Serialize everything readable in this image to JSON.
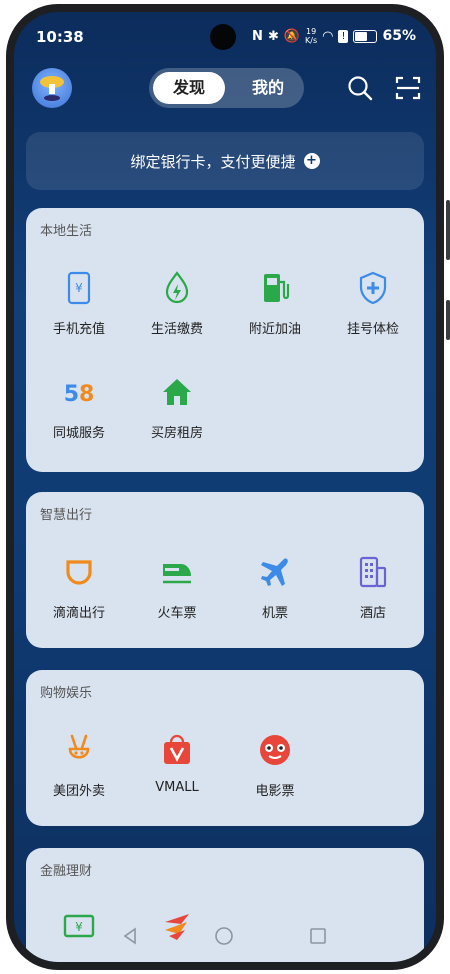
{
  "status": {
    "time": "10:38",
    "battery": "65%",
    "speed_top": "19",
    "speed_bottom": "K/s"
  },
  "header": {
    "tab_discover": "发现",
    "tab_mine": "我的"
  },
  "bind_card": {
    "text": "绑定银行卡，支付更便捷",
    "plus": "+"
  },
  "sections": [
    {
      "title": "本地生活",
      "items": [
        {
          "label": "手机充值",
          "icon": "phone-recharge-icon"
        },
        {
          "label": "生活缴费",
          "icon": "utility-bill-icon"
        },
        {
          "label": "附近加油",
          "icon": "gas-station-icon"
        },
        {
          "label": "挂号体检",
          "icon": "medical-shield-icon"
        },
        {
          "label": "同城服务",
          "icon": "58-logo-icon"
        },
        {
          "label": "买房租房",
          "icon": "house-icon"
        }
      ]
    },
    {
      "title": "智慧出行",
      "items": [
        {
          "label": "滴滴出行",
          "icon": "didi-icon"
        },
        {
          "label": "火车票",
          "icon": "train-icon"
        },
        {
          "label": "机票",
          "icon": "airplane-icon"
        },
        {
          "label": "酒店",
          "icon": "hotel-icon"
        }
      ]
    },
    {
      "title": "购物娱乐",
      "items": [
        {
          "label": "美团外卖",
          "icon": "meituan-icon"
        },
        {
          "label": "VMALL",
          "icon": "vmall-icon"
        },
        {
          "label": "电影票",
          "icon": "movie-ticket-icon"
        }
      ]
    },
    {
      "title": "金融理财",
      "items": [
        {
          "label": "",
          "icon": "cash-icon"
        },
        {
          "label": "",
          "icon": "finance-logo-icon"
        }
      ]
    }
  ],
  "colors": {
    "accent_blue": "#3d8be8",
    "green": "#2aa84a",
    "orange": "#f08a1e",
    "red": "#e8463a",
    "purple": "#6b62d6"
  }
}
